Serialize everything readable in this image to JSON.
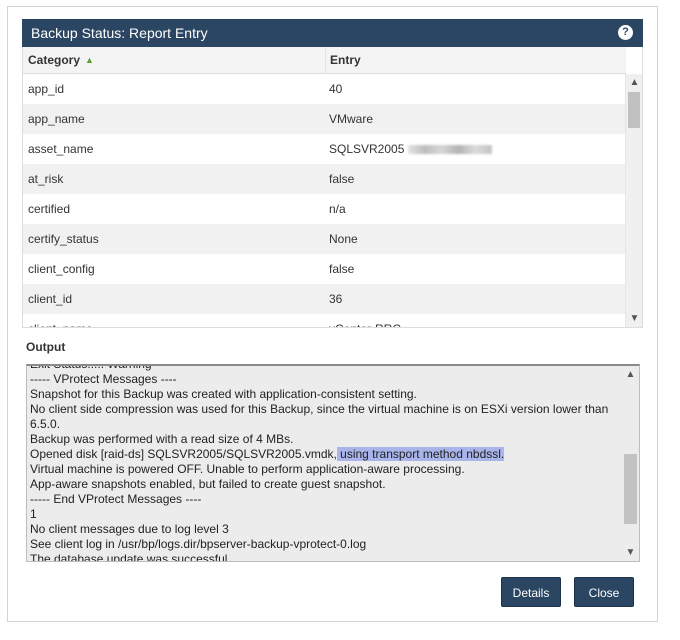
{
  "dialog": {
    "title": "Backup Status: Report Entry",
    "help_icon": "question-circle-icon",
    "help_glyph": "?"
  },
  "grid": {
    "columns": [
      "Category",
      "Entry"
    ],
    "sort_glyph": "▲",
    "rows": [
      {
        "category": "app_id",
        "entry": "40"
      },
      {
        "category": "app_name",
        "entry": "VMware"
      },
      {
        "category": "asset_name",
        "entry": "SQLSVR2005"
      },
      {
        "category": "at_risk",
        "entry": "false"
      },
      {
        "category": "certified",
        "entry": "n/a"
      },
      {
        "category": "certify_status",
        "entry": "None"
      },
      {
        "category": "client_config",
        "entry": "false"
      },
      {
        "category": "client_id",
        "entry": "36"
      },
      {
        "category": "client_name",
        "entry": "vCenter-RRC"
      }
    ],
    "scroll_up_glyph": "▲",
    "scroll_down_glyph": "▼"
  },
  "output": {
    "label": "Output",
    "lines": [
      "Exit Status..... Warning",
      "----- VProtect Messages ----",
      "Snapshot for this Backup was created with application-consistent setting.",
      "No client side compression was used for this Backup, since the virtual machine is on ESXi version lower than 6.5.0.",
      "Backup was performed with a read size of 4 MBs.",
      "Opened disk [raid-ds] SQLSVR2005/SQLSVR2005.vmdk,",
      "Virtual machine is powered OFF. Unable to perform application-aware processing.",
      "App-aware snapshots enabled, but failed to create guest snapshot.",
      "----- End VProtect Messages ----",
      "1",
      "No client messages due to log level 3",
      "See client log in /usr/bp/logs.dir/bpserver-backup-vprotect-0.log",
      "The database update was successful"
    ],
    "highlighted": " using transport method nbdssl.",
    "scroll_up_glyph": "▲",
    "scroll_down_glyph": "▼"
  },
  "buttons": {
    "details": "Details",
    "close": "Close"
  },
  "colors": {
    "header_bg": "#2b4663",
    "sort_arrow": "#5aa02c",
    "highlight": "#a8b4ea"
  }
}
